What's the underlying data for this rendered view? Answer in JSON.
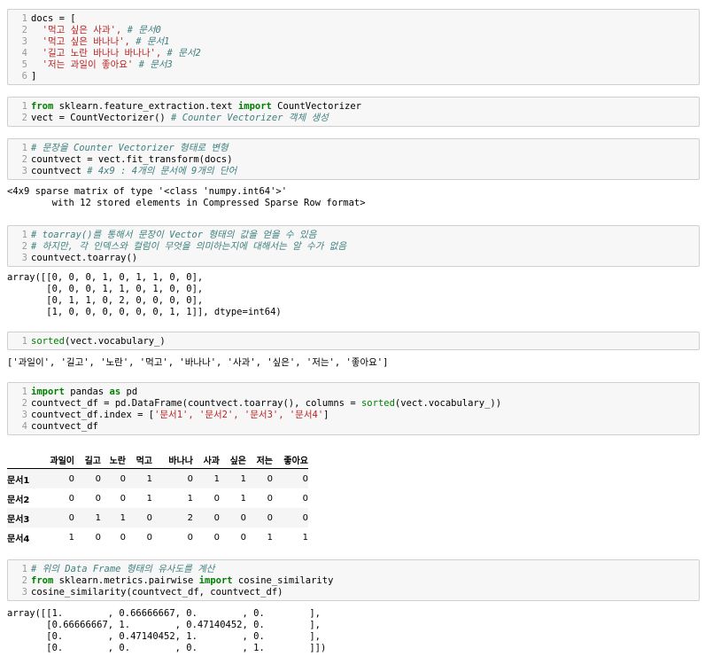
{
  "cell1": {
    "l1": "docs = [",
    "l2": "'먹고 싶은 사과',",
    "l2c": "# 문서0",
    "l3": "'먹고 싶은 바나나',",
    "l3c": "# 문서1",
    "l4": "'길고 노란 바나나 바나나',",
    "l4c": "# 문서2",
    "l5": "'저는 과일이 좋아요'",
    "l5c": "# 문서3",
    "l6": "]"
  },
  "cell2": {
    "l1_kw1": "from",
    "l1_mod": " sklearn.feature_extraction.text ",
    "l1_kw2": "import",
    "l1_name": " CountVectorizer",
    "l2_a": "vect = CountVectorizer() ",
    "l2c": "# Counter Vectorizer 객체 생성"
  },
  "cell3": {
    "l1c": "# 문장을 Counter Vectorizer 형태로 변형",
    "l2": "countvect = vect.fit_transform(docs)",
    "l3": "countvect ",
    "l3c": "# 4x9 : 4개의 문서에 9개의 단어"
  },
  "out3": "<4x9 sparse matrix of type '<class 'numpy.int64'>'\n        with 12 stored elements in Compressed Sparse Row format>",
  "cell4": {
    "l1c": "# toarray()를 통해서 문장이 Vector 형태의 값을 얻을 수 있음",
    "l2c": "# 하지만, 각 인덱스와 컬럼이 무엇을 의미하는지에 대해서는 알 수가 없음",
    "l3": "countvect.toarray()"
  },
  "out4": "array([[0, 0, 0, 1, 0, 1, 1, 0, 0],\n       [0, 0, 0, 1, 1, 0, 1, 0, 0],\n       [0, 1, 1, 0, 2, 0, 0, 0, 0],\n       [1, 0, 0, 0, 0, 0, 0, 1, 1]], dtype=int64)",
  "cell5": {
    "l1_fn": "sorted",
    "l1_rest": "(vect.vocabulary_)"
  },
  "out5": "['과일이', '길고', '노란', '먹고', '바나나', '사과', '싶은', '저는', '좋아요']",
  "cell6": {
    "l1_kw1": "import",
    "l1_mod": " pandas ",
    "l1_kw2": "as",
    "l1_name": " pd",
    "l2_a": "countvect_df = pd.DataFrame(countvect.toarray(), columns = ",
    "l2_fn": "sorted",
    "l2_b": "(vect.vocabulary_))",
    "l3_a": "countvect_df.index = [",
    "l3_s": "'문서1', '문서2', '문서3', '문서4'",
    "l3_b": "]",
    "l4": "countvect_df"
  },
  "df": {
    "columns": [
      "과일이",
      "길고",
      "노란",
      "먹고",
      "바나나",
      "사과",
      "싶은",
      "저는",
      "좋아요"
    ],
    "index": [
      "문서1",
      "문서2",
      "문서3",
      "문서4"
    ],
    "rows": [
      [
        0,
        0,
        0,
        1,
        0,
        1,
        1,
        0,
        0
      ],
      [
        0,
        0,
        0,
        1,
        1,
        0,
        1,
        0,
        0
      ],
      [
        0,
        1,
        1,
        0,
        2,
        0,
        0,
        0,
        0
      ],
      [
        1,
        0,
        0,
        0,
        0,
        0,
        0,
        1,
        1
      ]
    ]
  },
  "cell7": {
    "l1c": "# 위의 Data Frame 형태의 유사도를 계산",
    "l2_kw1": "from",
    "l2_mod": " sklearn.metrics.pairwise ",
    "l2_kw2": "import",
    "l2_name": " cosine_similarity",
    "l3": "cosine_similarity(countvect_df, countvect_df)"
  },
  "out7": "array([[1.        , 0.66666667, 0.        , 0.        ],\n       [0.66666667, 1.        , 0.47140452, 0.        ],\n       [0.        , 0.47140452, 1.        , 0.        ],\n       [0.        , 0.        , 0.        , 1.        ]])"
}
